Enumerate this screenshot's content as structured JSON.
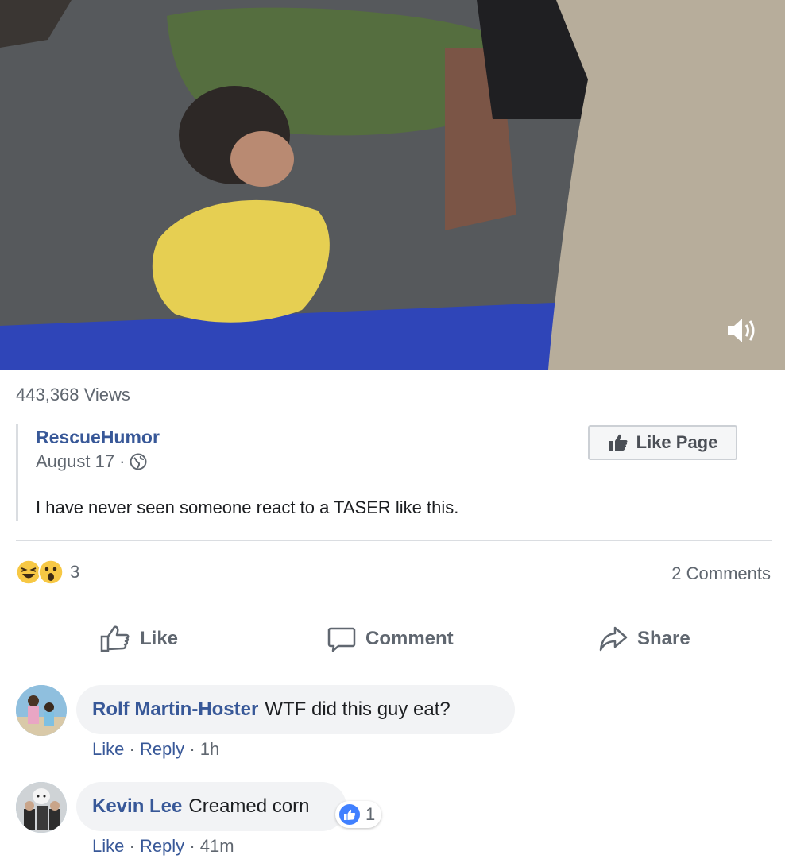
{
  "video": {
    "volume_icon": "volume-icon"
  },
  "stats": {
    "views": "443,368 Views"
  },
  "post": {
    "page_name": "RescueHumor",
    "date": "August 17",
    "separator": "·",
    "privacy_icon": "globe-icon",
    "text": "I have never seen someone react to a TASER like this."
  },
  "like_page_button": {
    "label": "Like Page",
    "icon": "thumbs-up-icon"
  },
  "reactions": {
    "icons": [
      "haha-icon",
      "wow-icon"
    ],
    "count": "3",
    "comments": "2 Comments"
  },
  "actions": {
    "like": "Like",
    "comment": "Comment",
    "share": "Share"
  },
  "comments": [
    {
      "author": "Rolf Martin-Hoster",
      "text": "WTF did this guy eat?",
      "like": "Like",
      "reply": "Reply",
      "time": "1h"
    },
    {
      "author": "Kevin Lee",
      "text": "Creamed corn",
      "like": "Like",
      "reply": "Reply",
      "time": "41m",
      "like_count": "1"
    }
  ],
  "colors": {
    "link_blue": "#385898",
    "meta_gray": "#606770",
    "bubble_gray": "#f2f3f5",
    "reaction_blue": "#4080ff"
  }
}
